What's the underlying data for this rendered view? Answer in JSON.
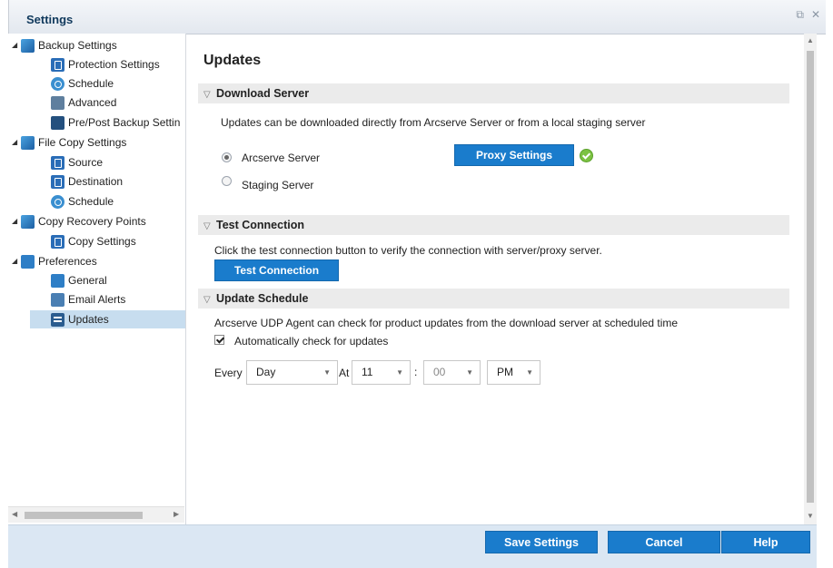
{
  "window": {
    "title": "Settings",
    "restore_icon": "restore-icon",
    "close_icon": "close-icon"
  },
  "tree": [
    {
      "label": "Backup Settings",
      "level": 0,
      "icon": "backup-icon",
      "expanded": true
    },
    {
      "label": "Protection Settings",
      "level": 1,
      "icon": "protection-icon"
    },
    {
      "label": "Schedule",
      "level": 1,
      "icon": "schedule-icon"
    },
    {
      "label": "Advanced",
      "level": 1,
      "icon": "advanced-icon"
    },
    {
      "label": "Pre/Post Backup Settin",
      "level": 1,
      "icon": "tools-icon"
    },
    {
      "label": "File Copy Settings",
      "level": 0,
      "icon": "file-copy-icon",
      "expanded": true
    },
    {
      "label": "Source",
      "level": 1,
      "icon": "source-icon"
    },
    {
      "label": "Destination",
      "level": 1,
      "icon": "destination-icon"
    },
    {
      "label": "Schedule",
      "level": 1,
      "icon": "schedule-icon"
    },
    {
      "label": "Copy Recovery Points",
      "level": 0,
      "icon": "copy-recovery-icon",
      "expanded": true
    },
    {
      "label": "Copy Settings",
      "level": 1,
      "icon": "copy-settings-icon"
    },
    {
      "label": "Preferences",
      "level": 0,
      "icon": "preferences-icon",
      "expanded": true
    },
    {
      "label": "General",
      "level": 1,
      "icon": "general-icon"
    },
    {
      "label": "Email Alerts",
      "level": 1,
      "icon": "email-icon"
    },
    {
      "label": "Updates",
      "level": 1,
      "icon": "updates-icon",
      "selected": true
    }
  ],
  "page": {
    "title": "Updates"
  },
  "download_server": {
    "header": "Download Server",
    "description": "Updates can be downloaded directly from Arcserve Server or from a local staging server",
    "option_arcserve": "Arcserve Server",
    "option_staging": "Staging Server",
    "selected": "Arcserve Server",
    "proxy_button": "Proxy Settings"
  },
  "test_connection": {
    "header": "Test Connection",
    "description": "Click the test connection button to verify the connection with server/proxy server.",
    "button": "Test Connection"
  },
  "update_schedule": {
    "header": "Update Schedule",
    "description": "Arcserve UDP Agent can check for product updates from the download server at scheduled time",
    "auto_check_label": "Automatically check for updates",
    "auto_check": true,
    "every_label": "Every",
    "frequency": "Day",
    "at_label": "At",
    "hour": "11",
    "colon": ":",
    "minute": "00",
    "ampm": "PM"
  },
  "footer": {
    "save": "Save Settings",
    "cancel": "Cancel",
    "help": "Help"
  },
  "colors": {
    "accent": "#1a7ccc",
    "selected": "#c7ddef",
    "footer": "#dbe7f3",
    "ok": "#7cc242"
  }
}
